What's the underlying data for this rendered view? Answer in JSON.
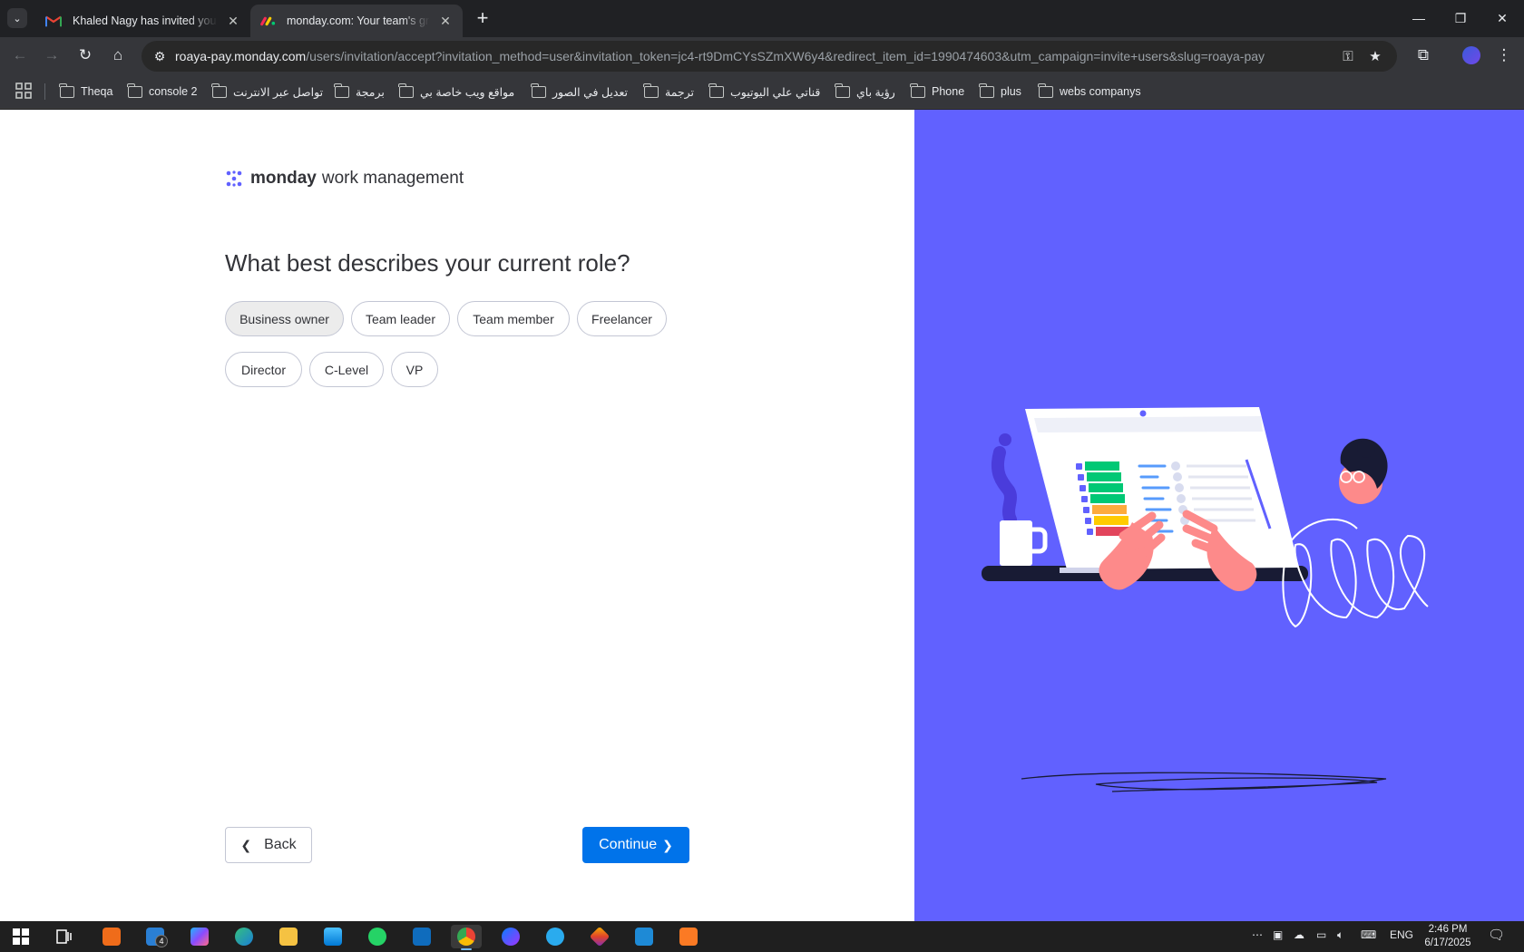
{
  "browser": {
    "tabs": [
      {
        "title": "Khaled Nagy has invited you to",
        "favicon": "gmail-icon"
      },
      {
        "title": "monday.com: Your team's grow",
        "favicon": "monday-icon",
        "active": true
      }
    ],
    "url_host": "roaya-pay.monday.com",
    "url_path": "/users/invitation/accept?invitation_method=user&invitation_token=jc4-rt9DmCYsSZmXW6y4&redirect_item_id=1990474603&utm_campaign=invite+users&slug=roaya-pay",
    "bookmarks": [
      "Theqa",
      "console 2",
      "تواصل عبر الانترنت",
      "برمجة",
      "مواقع ويب خاصة بي",
      "تعديل في الصور",
      "ترجمة",
      "قناتي علي اليوتيوب",
      "رؤية باي",
      "Phone",
      "plus",
      "webs companys"
    ]
  },
  "page": {
    "logo_brand": "monday",
    "logo_sub": "work management",
    "question": "What best describes your current role?",
    "roles": [
      "Business owner",
      "Team leader",
      "Team member",
      "Freelancer",
      "Director",
      "C-Level",
      "VP"
    ],
    "selected_role": "Business owner",
    "back_label": "Back",
    "continue_label": "Continue",
    "colors": {
      "accent": "#0073ea",
      "panel": "#6161ff",
      "text": "#323338"
    }
  },
  "taskbar": {
    "language": "ENG",
    "time": "2:46 PM",
    "date": "6/17/2025",
    "mail_badge": "4"
  }
}
